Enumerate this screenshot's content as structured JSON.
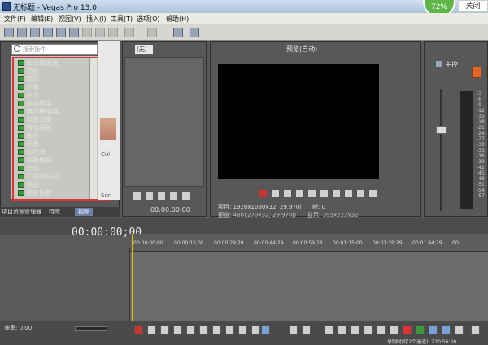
{
  "window": {
    "title": "无标题 - Vegas Pro 13.0",
    "close_label": "关闭",
    "cpu_percent": "72%"
  },
  "menu": [
    "文件(F)",
    "编辑(E)",
    "视图(V)",
    "插入(I)",
    "工具(T)",
    "选项(O)",
    "帮助(H)"
  ],
  "explorer": {
    "search_placeholder": "搜索插件",
    "items": [
      "降低数据量",
      "边框",
      "变形",
      "浮雕",
      "补光",
      "高清晰度",
      "电视模拟器",
      "电影效果",
      "转化面板",
      "发光",
      "影像",
      "防抖动",
      "高斯模糊",
      "光线",
      "广播的色彩",
      "黑白",
      "黑白恢复"
    ],
    "thumb_labels": [
      "Col",
      "Son"
    ],
    "tabs": [
      "项目资源管理器",
      "特效",
      "视频"
    ],
    "active_tab": "视频"
  },
  "trimmer": {
    "dropdown_value": "(无)",
    "timecode": "00:00:00:00"
  },
  "preview": {
    "dropdown_value": "预览(自动)",
    "project_label": "项目:",
    "project_value": "1920x1080x32, 29.970i",
    "preview_label": "预览:",
    "preview_value": "480x270x32, 29.970p",
    "frame_label": "帧:",
    "frame_value": "0",
    "display_label": "显示:",
    "display_value": "395x222x32"
  },
  "mixer": {
    "title": "主控",
    "meter_ticks": [
      "-3",
      "-6",
      "-9",
      "-12",
      "-15",
      "-18",
      "-21",
      "-24",
      "-27",
      "-30",
      "-33",
      "-36",
      "-39",
      "-42",
      "-45",
      "-48",
      "-51",
      "-54",
      "-57"
    ]
  },
  "timeline": {
    "timecode": "00:00:00;00",
    "ruler": [
      "00:00:00;00",
      "00:00:15;00",
      "00:00:29;29",
      "00:00:44;29",
      "00:00:59;28",
      "00:01:15;00",
      "00:01:29;29",
      "00:01:44;29",
      "00:"
    ]
  },
  "status": {
    "rate_label": "速率: 0.00",
    "record_time": "录制时间(2个通道): 230:56:00"
  }
}
